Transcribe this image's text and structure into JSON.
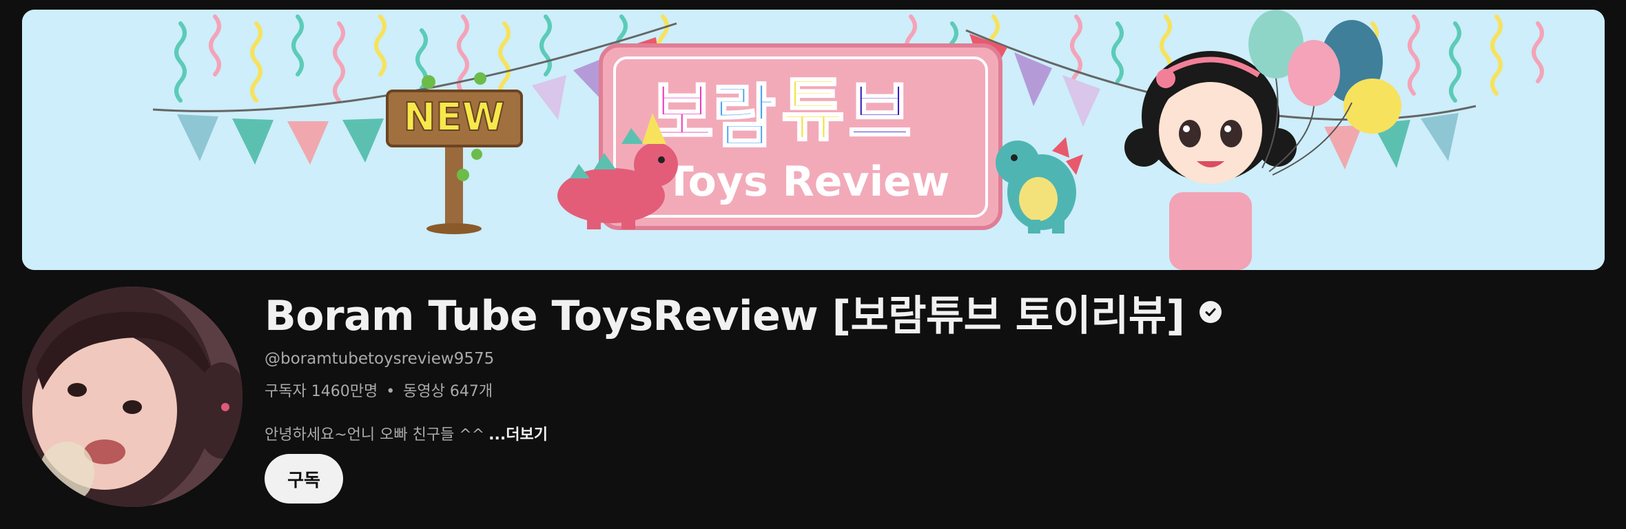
{
  "channel": {
    "name": "Boram Tube ToysReview [보람튜브 토이리뷰]",
    "handle": "@boramtubetoysreview9575",
    "subscribers": "구독자 1460만명",
    "separator": "•",
    "videos": "동영상 647개",
    "description": "안녕하세요~언니 오빠 친구들 ^^",
    "more_label": "...더보기",
    "subscribe_label": "구독"
  },
  "banner": {
    "sign_new": "NEW",
    "logo_korean": [
      "보",
      "람",
      "튜",
      "브"
    ],
    "logo_colors": [
      "#e83fbf",
      "#4aa3f0",
      "#f5e13c",
      "#3a1fc2"
    ],
    "logo_subtitle": "Toys Review"
  },
  "colors": {
    "background": "#0f0f0f",
    "banner_sky": "#cdeefa",
    "primary_text": "#f1f1f1",
    "secondary_text": "#aaaaaa"
  }
}
